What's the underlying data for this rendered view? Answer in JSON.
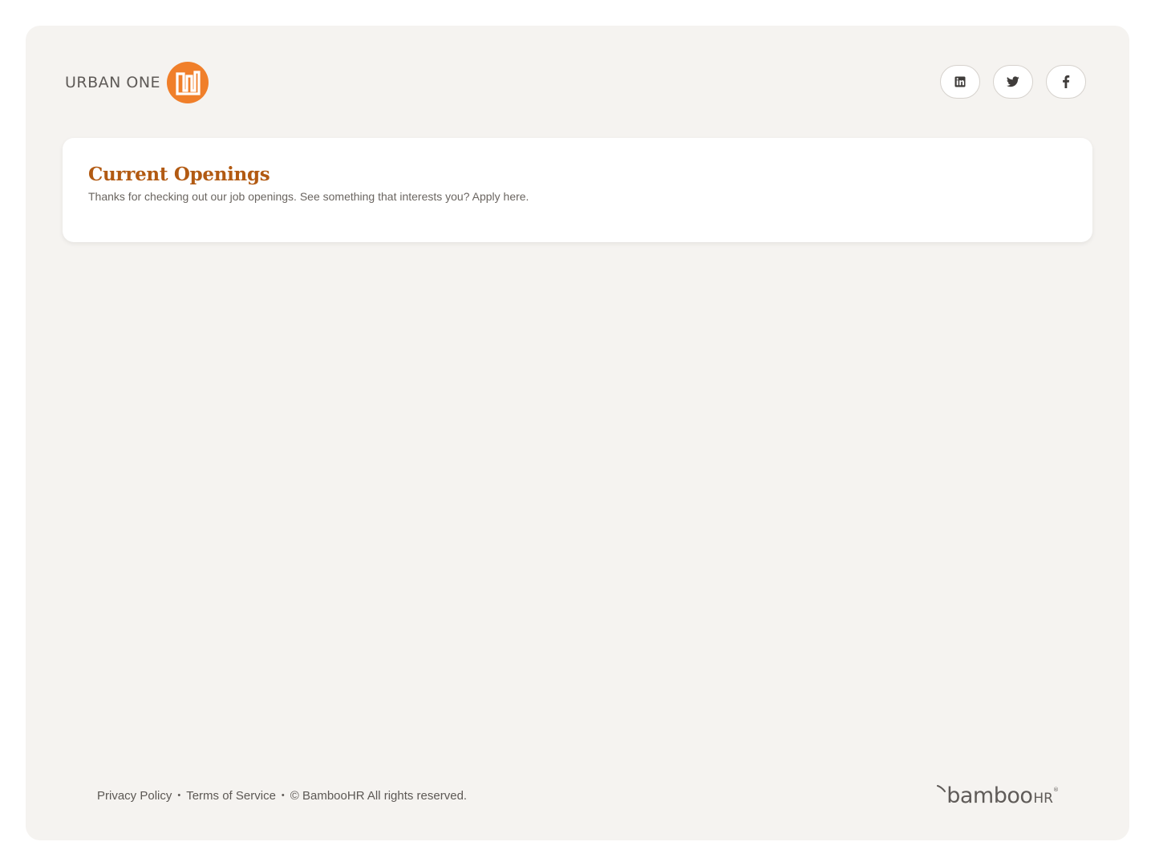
{
  "brand": {
    "name": "URBAN ONE",
    "mark_icon": "urban-one-logo-icon",
    "accent_color": "#f07f2a"
  },
  "social": [
    {
      "name": "linkedin",
      "icon": "linkedin-icon"
    },
    {
      "name": "twitter",
      "icon": "twitter-icon"
    },
    {
      "name": "facebook",
      "icon": "facebook-icon"
    }
  ],
  "openings": {
    "title": "Current Openings",
    "subtitle": "Thanks for checking out our job openings. See something that interests you? Apply here.",
    "title_color": "#b25a12"
  },
  "footer": {
    "privacy": "Privacy Policy",
    "terms": "Terms of Service",
    "separator": "•",
    "copyright": "© BambooHR All rights reserved.",
    "powered_by": {
      "main": "bamboo",
      "suffix": "HR",
      "trademark": "®"
    }
  }
}
